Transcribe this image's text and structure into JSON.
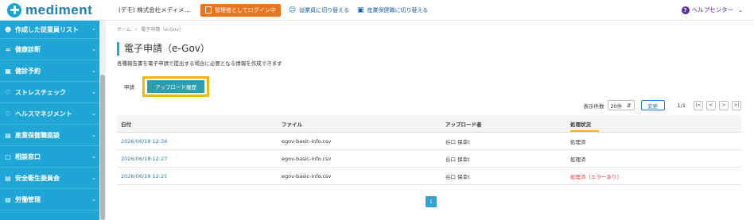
{
  "header": {
    "logo_text": "mediment",
    "company": "(デモ) 株式会社メディメ…",
    "admin_login": "管理者としてログイン中",
    "switch_employee": "従業員に切り替える",
    "switch_occupational_health": "産業保健職に切り替える",
    "help_center": "ヘルプセンター"
  },
  "sidebar": {
    "items": [
      {
        "icon": "people-list-icon",
        "label": "作成した従業員リスト"
      },
      {
        "icon": "stethoscope-icon",
        "label": "健康診断"
      },
      {
        "icon": "calendar-icon",
        "label": "健診予約"
      },
      {
        "icon": "heart-icon",
        "label": "ストレスチェック"
      },
      {
        "icon": "heart-icon",
        "label": "ヘルスマネジメント"
      },
      {
        "icon": "document-icon",
        "label": "産業保健職面談"
      },
      {
        "icon": "chat-icon",
        "label": "相談窓口"
      },
      {
        "icon": "document-icon",
        "label": "安全衛生委員会"
      },
      {
        "icon": "document-icon",
        "label": "労働管理"
      }
    ]
  },
  "breadcrumb": {
    "home": "ホーム",
    "separator": "›",
    "current": "電子申請（e-Gov）"
  },
  "page": {
    "title": "電子申請（e-Gov）",
    "description": "各種報告書を電子申請で提出する場合に必要となる情報を作成できます"
  },
  "tabs": {
    "apply": "申請",
    "upload_history": "アップロード履歴"
  },
  "controls": {
    "display_count_label": "表示件数",
    "per_page_value": "20件",
    "change_button": "変更",
    "page_info": "1/1",
    "first": "|<",
    "prev": "<",
    "next": ">",
    "last": ">|"
  },
  "table": {
    "headers": [
      "日付",
      "ファイル",
      "アップロード者",
      "処理状況"
    ],
    "rows": [
      {
        "date": "2026/06/18 12:34",
        "file": "egov-basic-info.csv",
        "uploader": "谷口 保幸t",
        "status": "処理済"
      },
      {
        "date": "2026/06/18 12:27",
        "file": "egov-basic-info.csv",
        "uploader": "谷口 保幸t",
        "status": "処理済"
      },
      {
        "date": "2026/06/18 12:25",
        "file": "egov-basic-info.csv",
        "uploader": "谷口 保幸t",
        "status": "処理済（エラーあり）"
      }
    ]
  },
  "pagination": {
    "current_page": "1"
  },
  "colors": {
    "accent": "#20a6d6",
    "brand": "#1e7fb8",
    "admin": "#e8741f",
    "highlight": "#f2b705",
    "tab_active": "#2e9ea8",
    "error": "#e53935"
  }
}
